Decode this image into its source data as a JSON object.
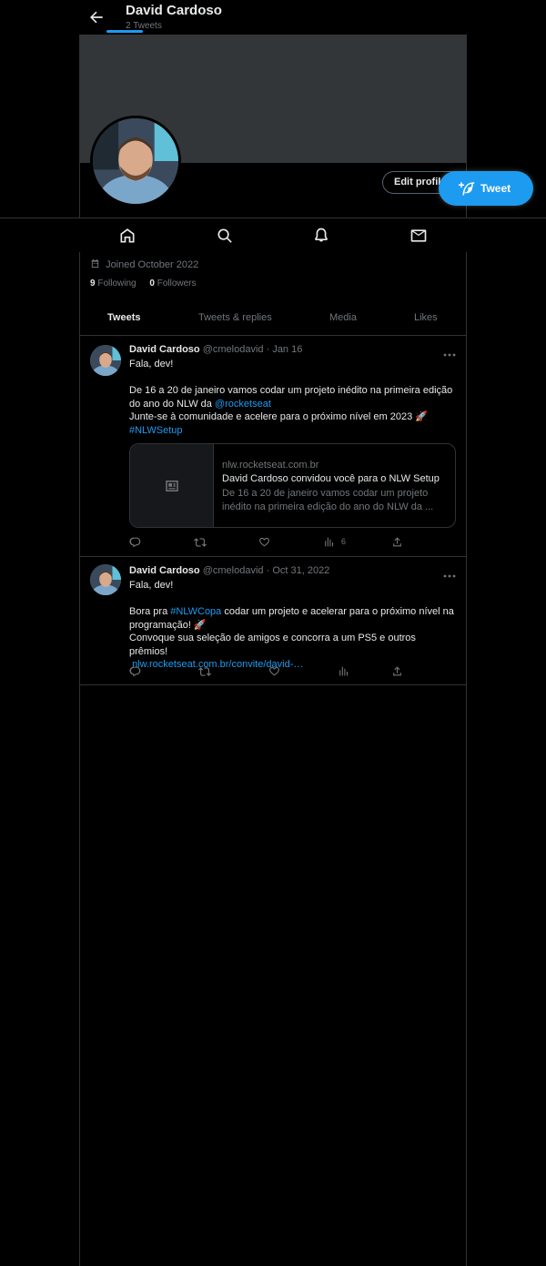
{
  "header": {
    "title": "David Cardoso",
    "subtitle": "2 Tweets"
  },
  "profile": {
    "edit_button": "Edit profile",
    "joined": "Joined October 2022",
    "following_count": "9",
    "following_label": "Following",
    "followers_count": "0",
    "followers_label": "Followers"
  },
  "fab": {
    "label": "Tweet"
  },
  "tabs": [
    {
      "label": "Tweets",
      "active": true
    },
    {
      "label": "Tweets & replies"
    },
    {
      "label": "Media"
    },
    {
      "label": "Likes"
    }
  ],
  "tweets": [
    {
      "name": "David Cardoso",
      "handle": "@cmelodavid",
      "sep": "·",
      "date": "Jan 16",
      "line1": "Fala, dev!",
      "line2a": "De 16 a 20 de janeiro vamos codar um projeto inédito na primeira edição",
      "line2b_pre": "do ano do NLW da ",
      "mention": "@rocketseat",
      "line3": "Junte-se à comunidade e acelere para o próximo nível em 2023 🚀",
      "hashtag": "#NLWSetup",
      "card": {
        "domain": "nlw.rocketseat.com.br",
        "title": "David Cardoso convidou você para o NLW Setup",
        "desc1": "De 16 a 20 de janeiro vamos codar um projeto",
        "desc2": "inédito na primeira edição do ano do NLW da ..."
      },
      "views": "6"
    },
    {
      "name": "David Cardoso",
      "handle": "@cmelodavid",
      "sep": "·",
      "date": "Oct 31, 2022",
      "line1": "Fala, dev!",
      "line2_pre": "Bora pra ",
      "hashtag": "#NLWCopa",
      "line2_post": " codar um projeto e acelerar para o próximo nível na",
      "line3": "programação! 🚀",
      "line4": "Convoque sua seleção de amigos e concorra a um PS5 e outros prêmios!",
      "url": "nlw.rocketseat.com.br/convite/david-…"
    }
  ],
  "colors": {
    "accent": "#1d9bf0",
    "background": "#000000",
    "border": "#2f3336",
    "muted": "#71767b",
    "text": "#e7e9ea",
    "banner": "#333639"
  },
  "icons": [
    "back-arrow-icon",
    "home-icon",
    "search-icon",
    "bell-icon",
    "mail-icon",
    "feather-plus-icon",
    "calendar-icon",
    "more-icon",
    "reply-icon",
    "retweet-icon",
    "like-icon",
    "views-icon",
    "share-icon",
    "article-icon"
  ]
}
